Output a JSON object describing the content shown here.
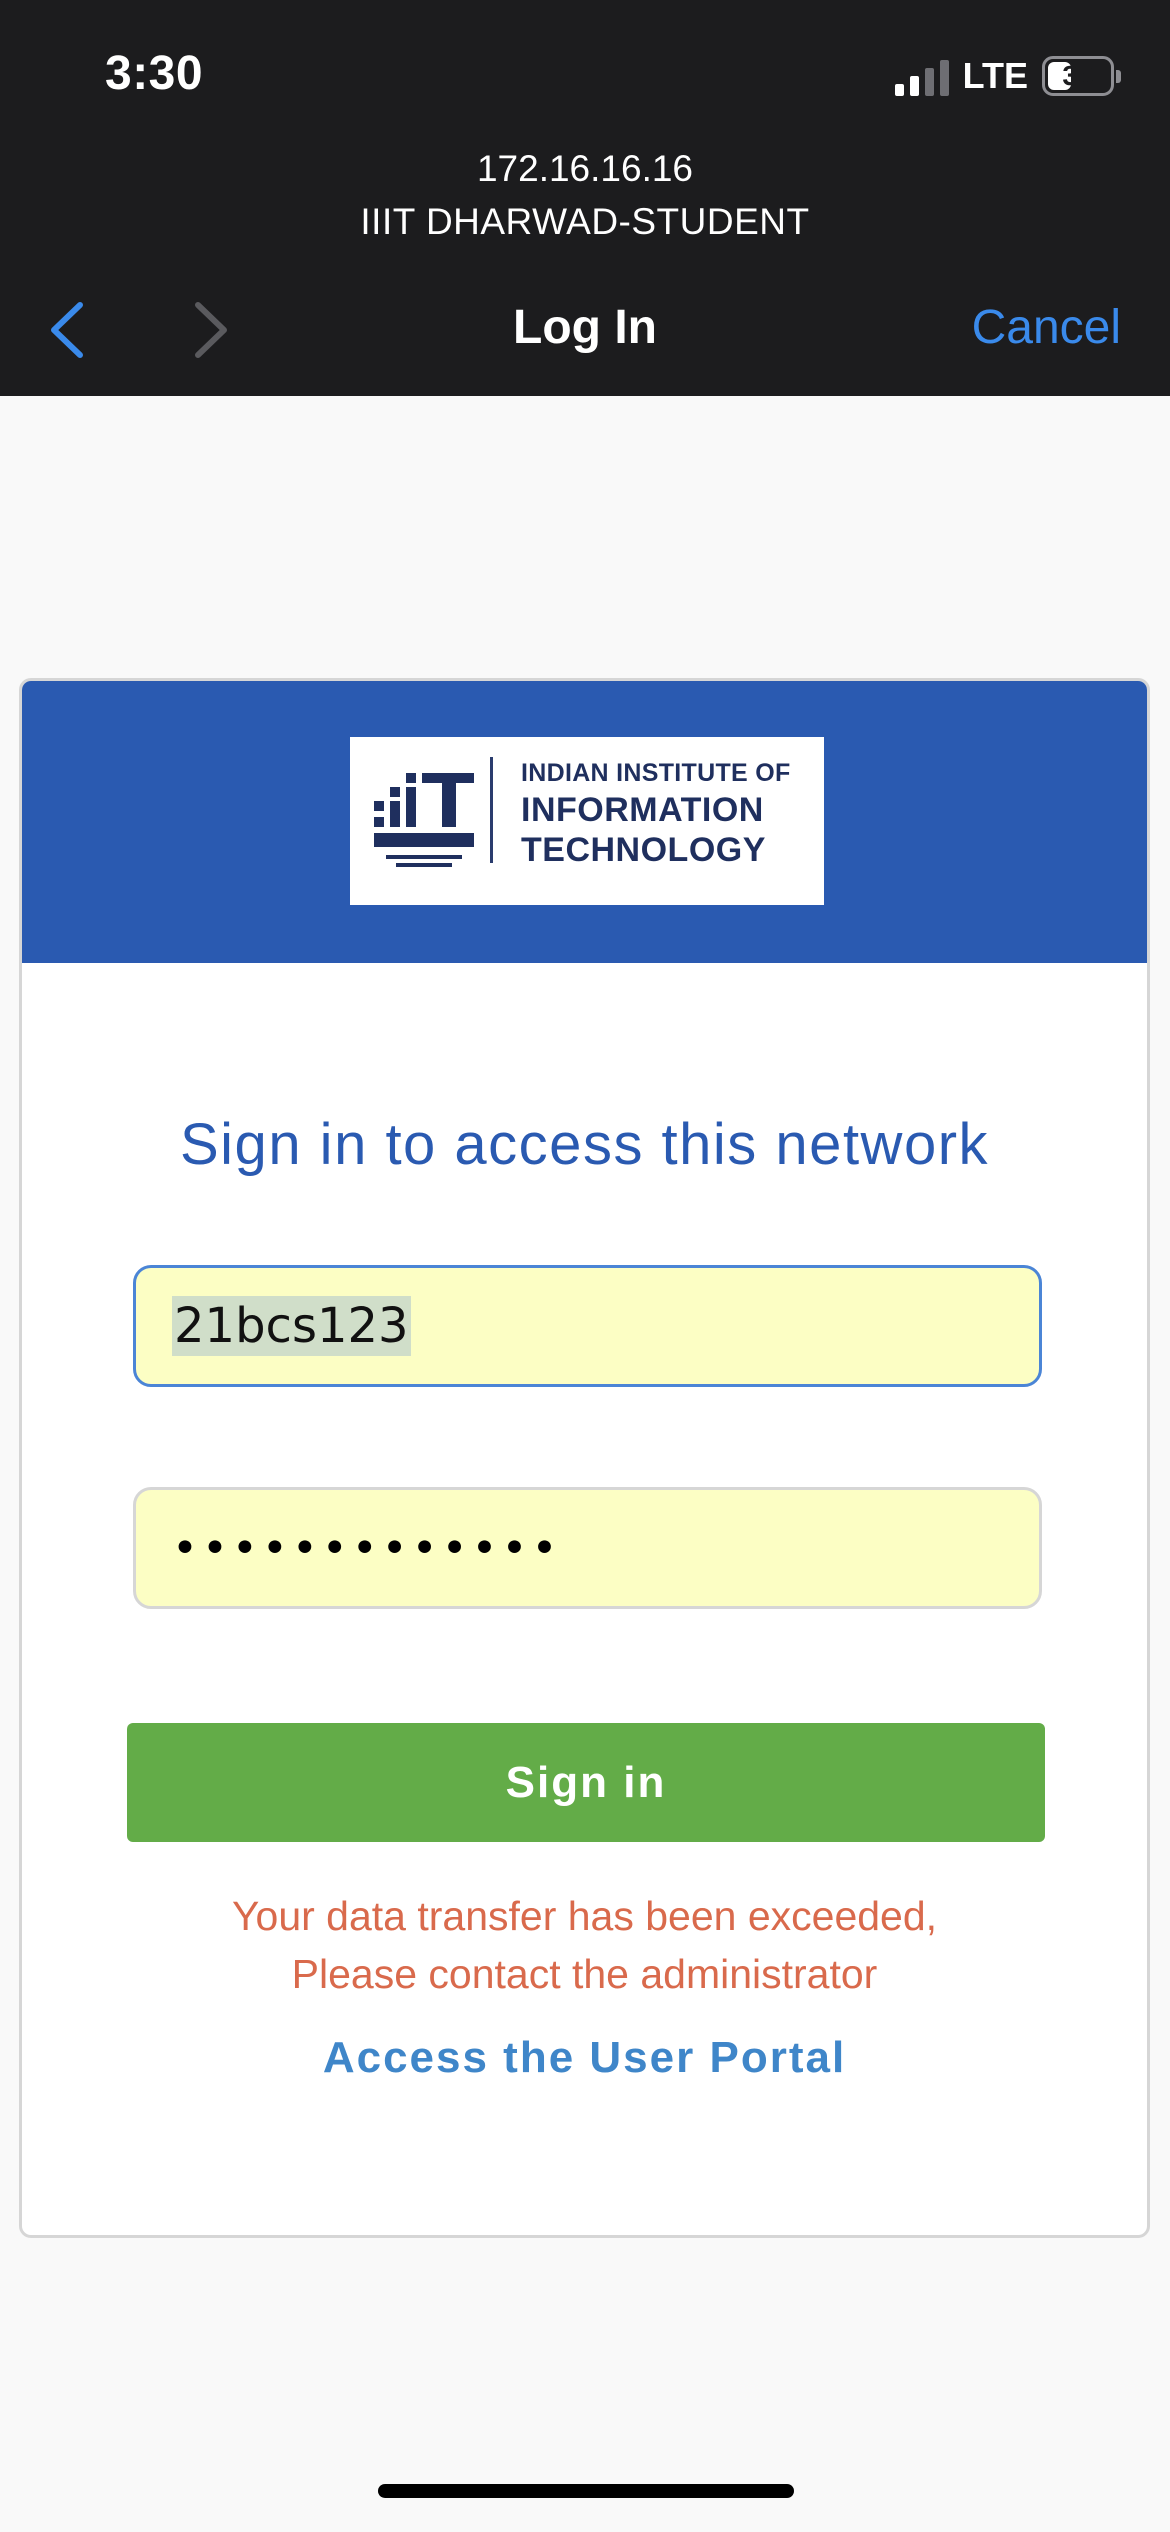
{
  "status_bar": {
    "time": "3:30",
    "network_type": "LTE",
    "battery_percent": "35"
  },
  "captive_portal": {
    "address": "172.16.16.16",
    "network_name": "IIIT DHARWAD-STUDENT"
  },
  "nav": {
    "title": "Log In",
    "cancel_label": "Cancel"
  },
  "logo": {
    "line1": "INDIAN INSTITUTE OF",
    "line2": "INFORMATION",
    "line3": "TECHNOLOGY"
  },
  "form": {
    "heading": "Sign in to access this network",
    "username_value": "21bcs123",
    "password_masked": "•••••••••••••",
    "signin_label": "Sign in",
    "error_line1": "Your data transfer has been exceeded,",
    "error_line2": "Please contact the administrator",
    "portal_link": "Access the User Portal"
  },
  "colors": {
    "topbar_bg": "#1c1c1e",
    "ios_link_blue": "#3a8aeb",
    "header_blue": "#2a5ab1",
    "field_fill": "#fcfec4",
    "button_green": "#63ac48",
    "error_orange": "#d96a4c",
    "portal_link_blue": "#3f86c9"
  },
  "icons": {
    "back": "chevron-left-icon",
    "forward": "chevron-right-icon",
    "signal": "signal-bars-icon",
    "battery": "battery-icon"
  }
}
